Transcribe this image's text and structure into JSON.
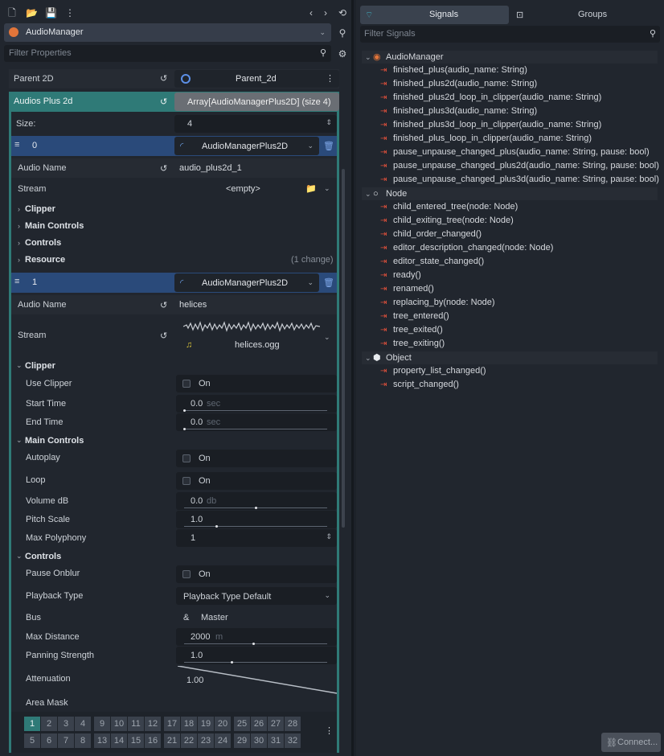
{
  "inspector": {
    "node_name": "AudioManager",
    "filter_placeholder": "Filter Properties",
    "parent2d": {
      "label": "Parent 2D",
      "value": "Parent_2d"
    },
    "audios": {
      "label": "Audios Plus 2d",
      "value": "Array[AudioManagerPlus2D] (size 4)",
      "size_label": "Size:",
      "size_value": "4"
    },
    "item0": {
      "index": "0",
      "type": "AudioManagerPlus2D",
      "audio_name_label": "Audio Name",
      "audio_name": "audio_plus2d_1",
      "stream_label": "Stream",
      "stream_value": "<empty>",
      "sections": [
        "Clipper",
        "Main Controls",
        "Controls",
        "Resource"
      ],
      "change_note": "(1 change)"
    },
    "item1": {
      "index": "1",
      "type": "AudioManagerPlus2D",
      "audio_name_label": "Audio Name",
      "audio_name": "helices",
      "stream_label": "Stream",
      "stream_file": "helices.ogg",
      "clipper": {
        "title": "Clipper",
        "use_clipper_label": "Use Clipper",
        "on": "On",
        "start_label": "Start Time",
        "start_value": "0.0",
        "end_label": "End Time",
        "end_value": "0.0",
        "unit": "sec"
      },
      "main": {
        "title": "Main Controls",
        "autoplay_label": "Autoplay",
        "loop_label": "Loop",
        "on": "On",
        "volume_label": "Volume dB",
        "volume_value": "0.0",
        "volume_unit": "db",
        "pitch_label": "Pitch Scale",
        "pitch_value": "1.0",
        "poly_label": "Max Polyphony",
        "poly_value": "1"
      },
      "controls": {
        "title": "Controls",
        "pause_label": "Pause Onblur",
        "on": "On",
        "playback_label": "Playback Type",
        "playback_value": "Playback Type Default",
        "bus_label": "Bus",
        "bus_icon": "&",
        "bus_value": "Master",
        "maxdist_label": "Max Distance",
        "maxdist_value": "2000",
        "maxdist_unit": "m",
        "pan_label": "Panning Strength",
        "pan_value": "1.0",
        "atten_label": "Attenuation",
        "atten_value": "1.00",
        "mask_label": "Area Mask"
      },
      "mask_row1": [
        "1",
        "2",
        "3",
        "4",
        "9",
        "10",
        "11",
        "12",
        "17",
        "18",
        "19",
        "20",
        "25",
        "26",
        "27",
        "28"
      ],
      "mask_row2": [
        "5",
        "6",
        "7",
        "8",
        "13",
        "14",
        "15",
        "16",
        "21",
        "22",
        "23",
        "24",
        "29",
        "30",
        "31",
        "32"
      ]
    }
  },
  "signals_panel": {
    "tab_signals": "Signals",
    "tab_groups": "Groups",
    "filter_placeholder": "Filter Signals",
    "groups": [
      {
        "name": "AudioManager",
        "signals": [
          "finished_plus(audio_name: String)",
          "finished_plus2d(audio_name: String)",
          "finished_plus2d_loop_in_clipper(audio_name: String)",
          "finished_plus3d(audio_name: String)",
          "finished_plus3d_loop_in_clipper(audio_name: String)",
          "finished_plus_loop_in_clipper(audio_name: String)",
          "pause_unpause_changed_plus(audio_name: String, pause: bool)",
          "pause_unpause_changed_plus2d(audio_name: String, pause: bool)",
          "pause_unpause_changed_plus3d(audio_name: String, pause: bool)"
        ]
      },
      {
        "name": "Node",
        "signals": [
          "child_entered_tree(node: Node)",
          "child_exiting_tree(node: Node)",
          "child_order_changed()",
          "editor_description_changed(node: Node)",
          "editor_state_changed()",
          "ready()",
          "renamed()",
          "replacing_by(node: Node)",
          "tree_entered()",
          "tree_exited()",
          "tree_exiting()"
        ]
      },
      {
        "name": "Object",
        "signals": [
          "property_list_changed()",
          "script_changed()"
        ]
      }
    ],
    "connect_button": "Connect..."
  },
  "colors": {
    "accent": "#2f7a77",
    "array_header": "#2a4a7a",
    "signal_icon": "#e0503b"
  }
}
